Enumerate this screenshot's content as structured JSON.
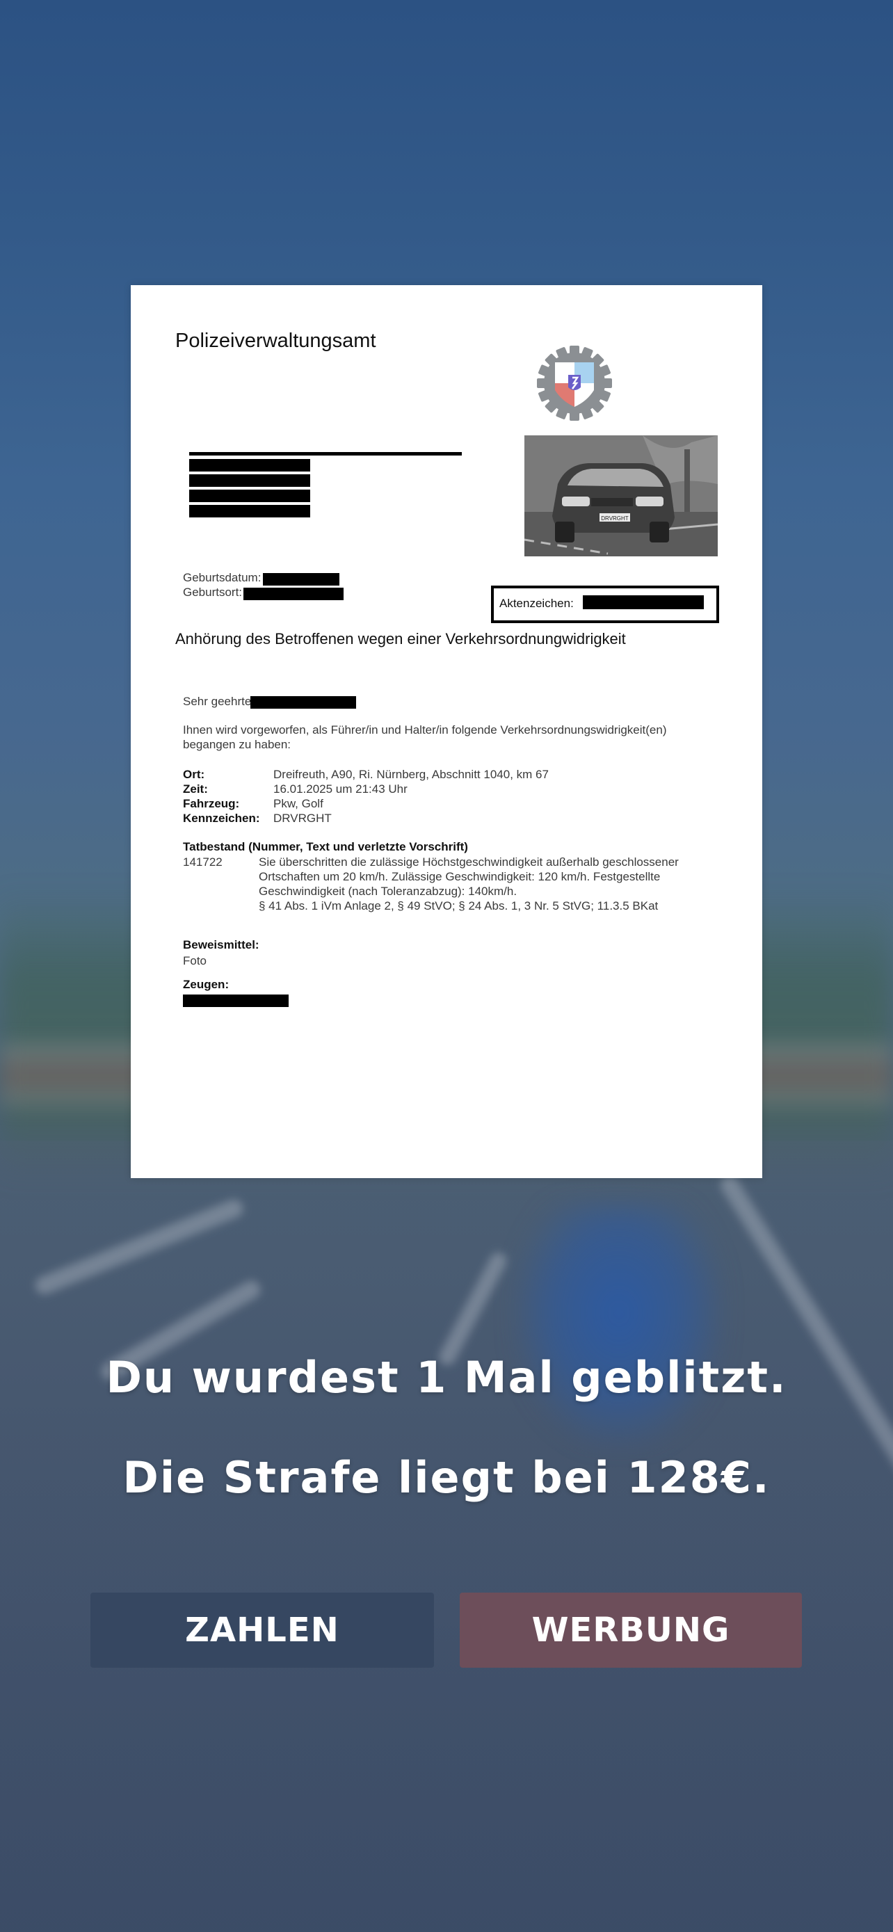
{
  "document": {
    "authority": "Polizeiverwaltungsamt",
    "birth_date_label": "Geburtsdatum:",
    "birth_place_label": "Geburtsort:",
    "file_number_label": "Aktenzeichen:",
    "heading": "Anhörung des Betroffenen wegen einer Verkehrsordnungwidrigkeit",
    "salutation": "Sehr geehrte",
    "intro_line1": "Ihnen wird vorgeworfen, als Führer/in und Halter/in folgende Verkehrsordnungswidrigkeit(en)",
    "intro_line2": "begangen zu haben:",
    "details": {
      "place_label": "Ort:",
      "place_value": "Dreifreuth, A90, Ri. Nürnberg, Abschnitt 1040, km 67",
      "time_label": "Zeit:",
      "time_value": "16.01.2025 um 21:43 Uhr",
      "vehicle_label": "Fahrzeug:",
      "vehicle_value": "Pkw, Golf",
      "plate_label": "Kennzeichen:",
      "plate_value": "DRVRGHT"
    },
    "offense": {
      "heading": "Tatbestand (Nummer, Text und verletzte Vorschrift)",
      "number": "141722",
      "line1": "Sie überschritten die zulässige Höchstgeschwindigkeit außerhalb geschlossener",
      "line2": "Ortschaften um 20 km/h. Zulässige Geschwindigkeit: 120 km/h. Festgestellte",
      "line3": "Geschwindigkeit (nach Toleranzabzug): 140km/h.",
      "line4": "§ 41 Abs. 1 iVm Anlage 2, § 49 StVO; § 24 Abs. 1, 3 Nr. 5 StVG; 11.3.5 BKat"
    },
    "evidence_label": "Beweismittel:",
    "evidence_value": "Foto",
    "witness_label": "Zeugen:",
    "photo_plate": "DRVRGHT"
  },
  "result": {
    "line1": "Du wurdest 1 Mal geblitzt.",
    "line2": "Die Strafe liegt bei 128€."
  },
  "buttons": {
    "pay": "ZAHLEN",
    "ad": "WERBUNG"
  },
  "colors": {
    "pay_button": "#364761",
    "ad_button": "#6d4e5a",
    "background": "#3e5a80"
  }
}
